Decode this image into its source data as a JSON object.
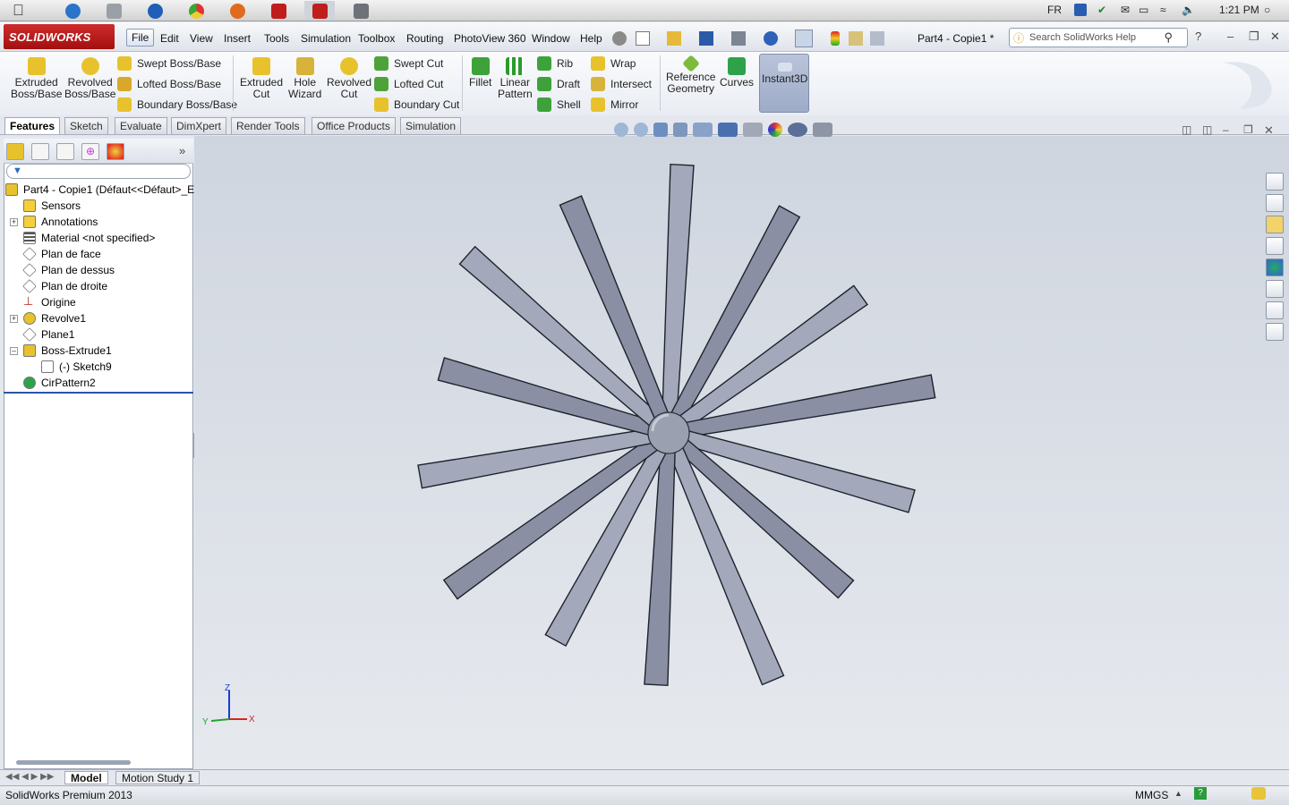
{
  "os_bar": {
    "language": "FR",
    "time": "1:21 PM"
  },
  "app": {
    "logo_text": "SOLIDWORKS",
    "document_title": "Part4 - Copie1 *",
    "search_placeholder": "Search SolidWorks Help"
  },
  "menu": [
    "File",
    "Edit",
    "View",
    "Insert",
    "Tools",
    "Simulation",
    "Toolbox",
    "Routing",
    "PhotoView 360",
    "Window",
    "Help"
  ],
  "commands": {
    "extruded_boss": "Extruded\nBoss/Base",
    "revolved_boss": "Revolved\nBoss/Base",
    "swept_boss": "Swept Boss/Base",
    "lofted_boss": "Lofted Boss/Base",
    "boundary_boss": "Boundary Boss/Base",
    "extruded_cut": "Extruded\nCut",
    "hole_wizard": "Hole\nWizard",
    "revolved_cut": "Revolved\nCut",
    "swept_cut": "Swept Cut",
    "lofted_cut": "Lofted Cut",
    "boundary_cut": "Boundary Cut",
    "fillet": "Fillet",
    "linear_pattern": "Linear\nPattern",
    "rib": "Rib",
    "draft": "Draft",
    "shell": "Shell",
    "wrap": "Wrap",
    "intersect": "Intersect",
    "mirror": "Mirror",
    "reference_geometry": "Reference\nGeometry",
    "curves": "Curves",
    "instant3d": "Instant3D"
  },
  "tabs": [
    "Features",
    "Sketch",
    "Evaluate",
    "DimXpert",
    "Render Tools",
    "Office Products",
    "Simulation"
  ],
  "active_tab": "Features",
  "tree": {
    "root": "Part4 - Copie1  (Défaut<<Défaut>_E",
    "items": [
      "Sensors",
      "Annotations",
      "Material <not specified>",
      "Plan de face",
      "Plan de dessus",
      "Plan de droite",
      "Origine",
      "Revolve1",
      "Plane1",
      "Boss-Extrude1",
      "(-) Sketch9",
      "CirPattern2"
    ]
  },
  "triad": {
    "z": "Z",
    "y": "Y",
    "x": "X"
  },
  "bottom_tabs": [
    "Model",
    "Motion Study 1"
  ],
  "status": {
    "product": "SolidWorks Premium 2013",
    "units": "MMGS"
  },
  "colors": {
    "blade": "#8a8fa3",
    "blade_light": "#a3a8bb",
    "accent_red": "#c01d1d"
  }
}
